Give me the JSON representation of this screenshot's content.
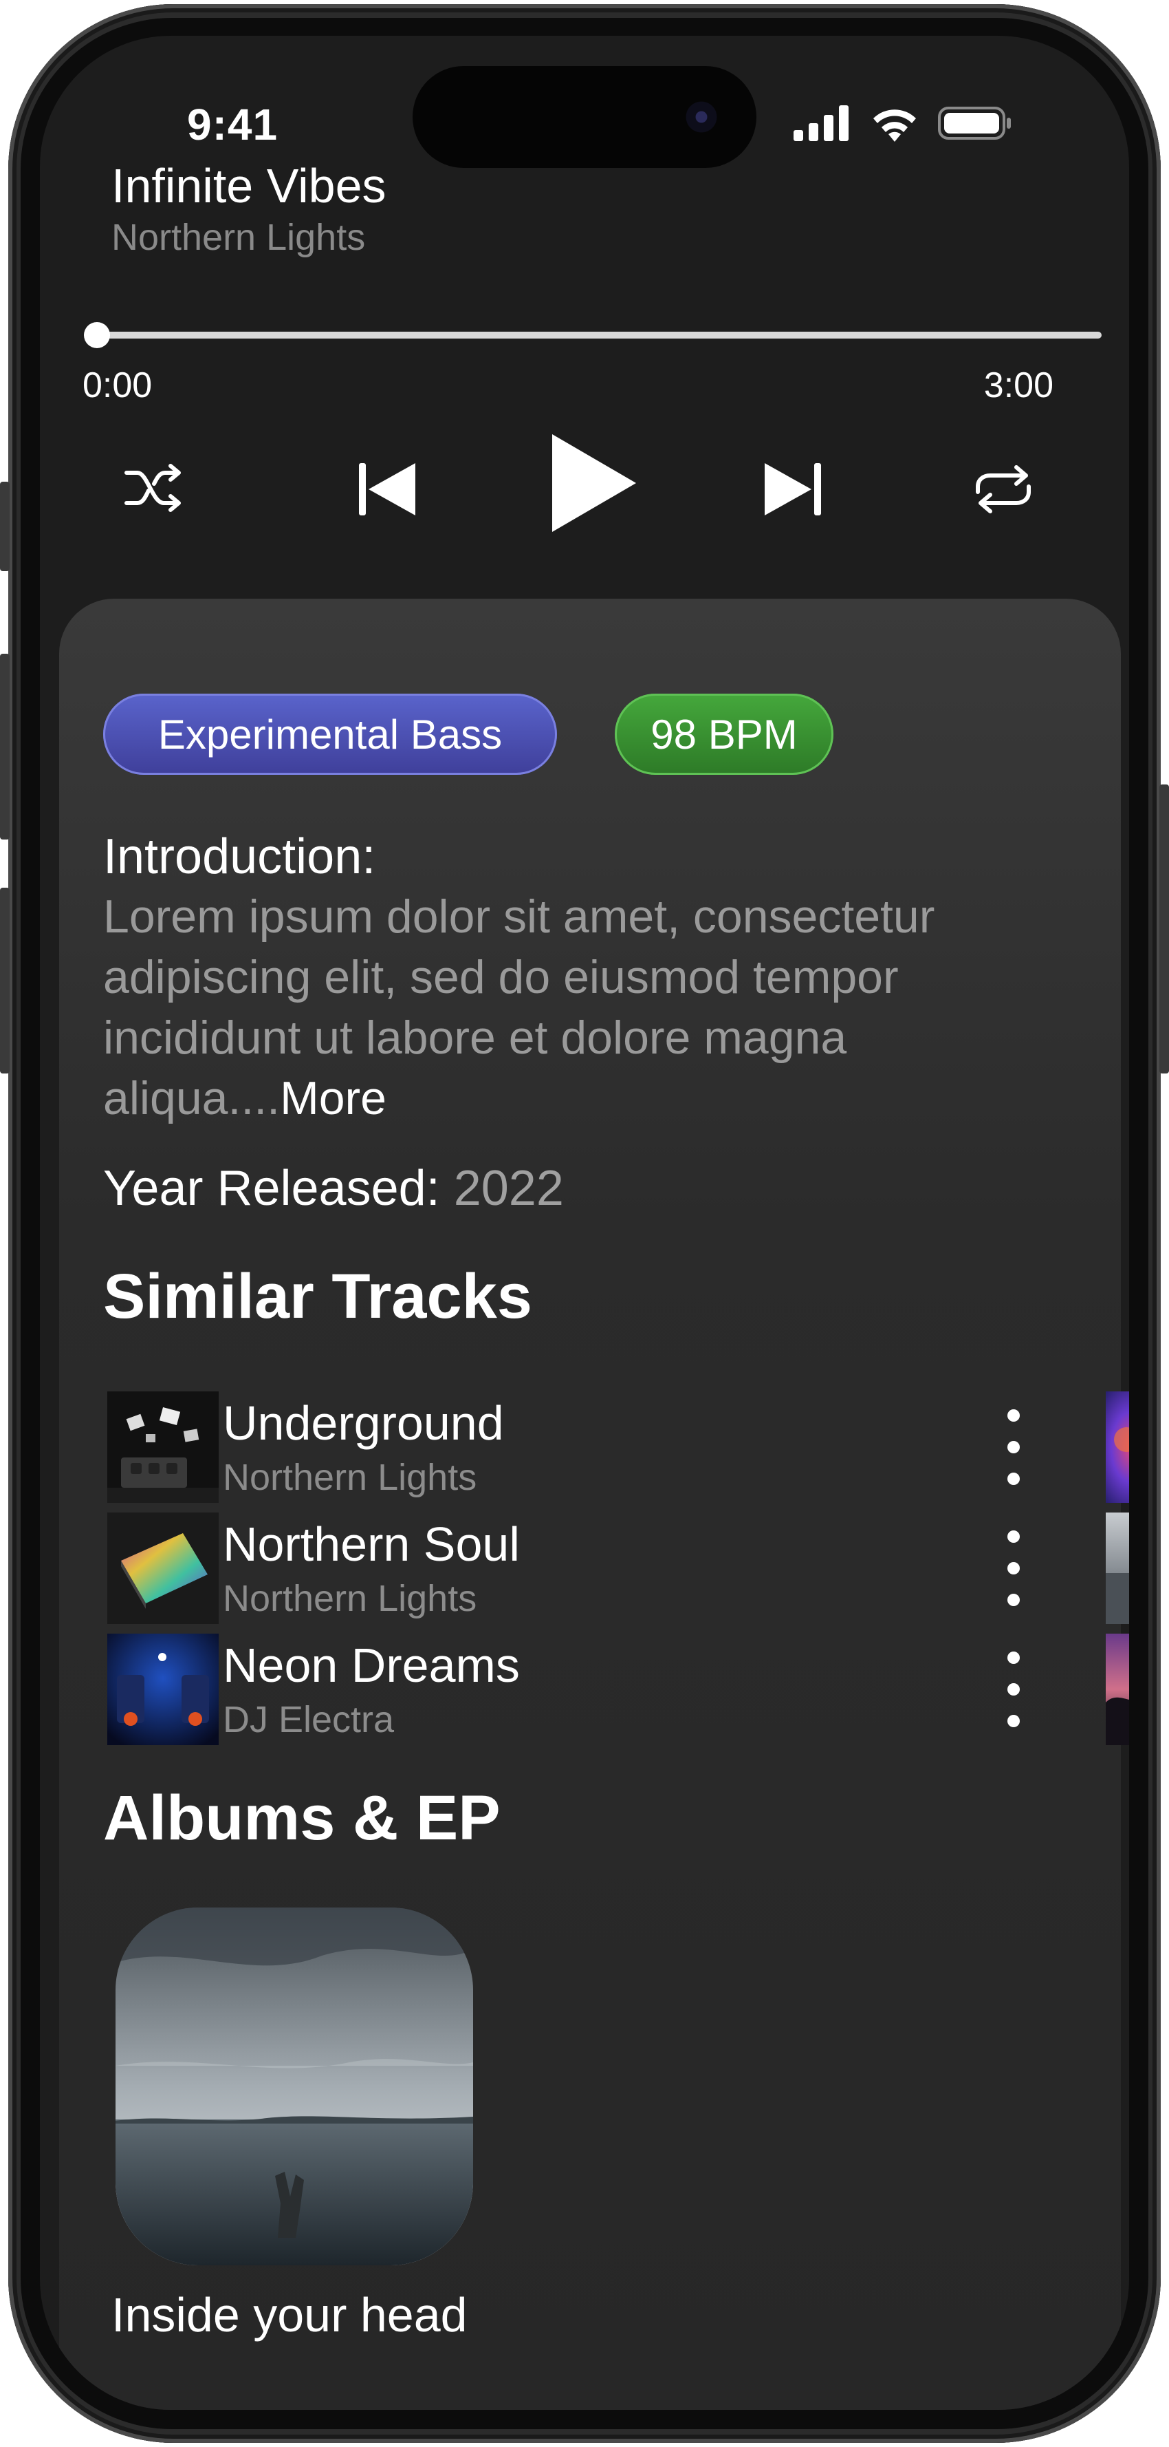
{
  "status": {
    "time": "9:41"
  },
  "now_playing": {
    "title": "Infinite Vibes",
    "artist": "Northern Lights",
    "progress": 0.0,
    "current_time": "0:00",
    "total_time": "3:00"
  },
  "controls": {
    "shuffle_icon": "shuffle-icon",
    "previous_icon": "skip-previous-icon",
    "play_icon": "play-icon",
    "next_icon": "skip-next-icon",
    "repeat_icon": "repeat-icon"
  },
  "tags": {
    "genre": "Experimental Bass",
    "bpm": "98 BPM"
  },
  "colors": {
    "genre_pill": "#4a52b4",
    "bpm_pill": "#38902f",
    "background": "#1d1d1d",
    "card": "#2f2f2f"
  },
  "intro": {
    "heading": "Introduction:",
    "text": "Lorem ipsum dolor sit amet, consectetur adipiscing elit, sed do eiusmod tempor incididunt ut labore et dolore magna aliqua....",
    "more_label": "More"
  },
  "year": {
    "label": "Year Released:",
    "value": "2022"
  },
  "similar": {
    "heading": "Similar Tracks",
    "tracks": [
      {
        "name": "Underground",
        "artist": "Northern Lights"
      },
      {
        "name": "Northern Soul",
        "artist": "Northern Lights"
      },
      {
        "name": "Neon Dreams",
        "artist": "DJ Electra"
      }
    ]
  },
  "albums": {
    "heading": "Albums & EP",
    "items": [
      {
        "name": "Inside your head"
      }
    ]
  }
}
